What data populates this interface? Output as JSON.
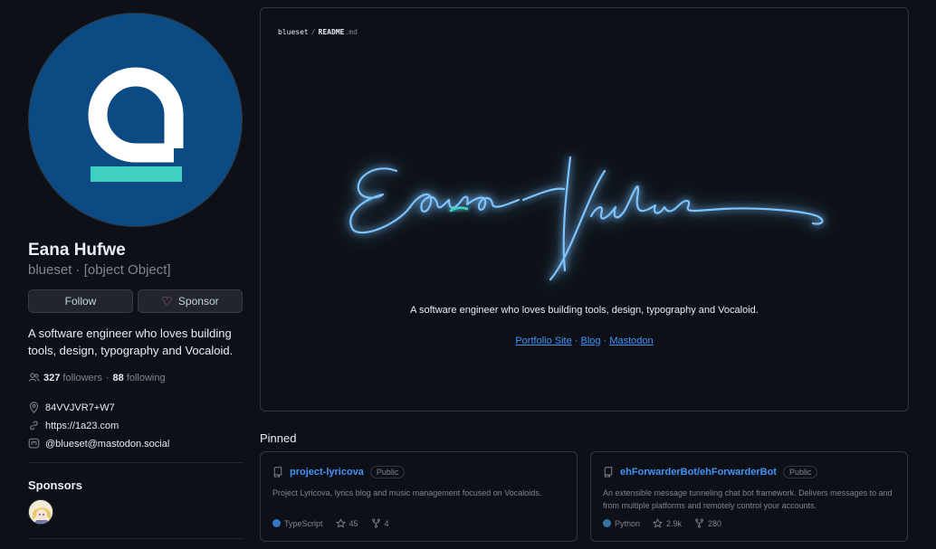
{
  "profile": {
    "name": "Eana Hufwe",
    "login_line": "blueset · [object Object]",
    "follow_label": "Follow",
    "sponsor_label": "Sponsor",
    "bio": "A software engineer who loves building tools, design, typography and Vocaloid.",
    "followers_count": "327",
    "followers_label": "followers",
    "following_count": "88",
    "following_label": "following",
    "separator": "·",
    "location": "84VVJVR7+W7",
    "website": "https://1a23.com",
    "mastodon": "@blueset@mastodon.social",
    "avatar_colors": {
      "background": "#0c4a84",
      "glyph": "#ffffff",
      "bar": "#3fd1c0"
    }
  },
  "sponsors": {
    "heading": "Sponsors"
  },
  "readme": {
    "owner": "blueset",
    "separator": "/",
    "filename": "README",
    "extension": ".md",
    "bio": "A software engineer who loves building tools, design, typography and Vocaloid.",
    "links": [
      {
        "label": "Portfolio Site"
      },
      {
        "label": "Blog"
      },
      {
        "label": "Mastodon"
      }
    ],
    "link_separator": "·",
    "neon_color": "#7cc4ff",
    "accent_color": "#3fd1c0"
  },
  "pinned": {
    "heading": "Pinned",
    "repos": [
      {
        "name": "project-lyricova",
        "visibility": "Public",
        "description": "Project Lyricova, lyrics blog and music management focused on Vocaloids.",
        "language": "TypeScript",
        "language_color": "#3178c6",
        "stars": "45",
        "forks": "4"
      },
      {
        "name": "ehForwarderBot/ehForwarderBot",
        "visibility": "Public",
        "description": "An extensible message tunneling chat bot framework. Delivers messages to and from multiple platforms and remotely control your accounts.",
        "language": "Python",
        "language_color": "#3572a5",
        "stars": "2.9k",
        "forks": "280"
      }
    ]
  },
  "icons": {
    "people": "people-icon",
    "location": "location-icon",
    "link": "link-icon",
    "mastodon": "mastodon-icon",
    "heart": "heart-icon",
    "repo": "repo-icon",
    "star": "star-icon",
    "fork": "fork-icon"
  }
}
